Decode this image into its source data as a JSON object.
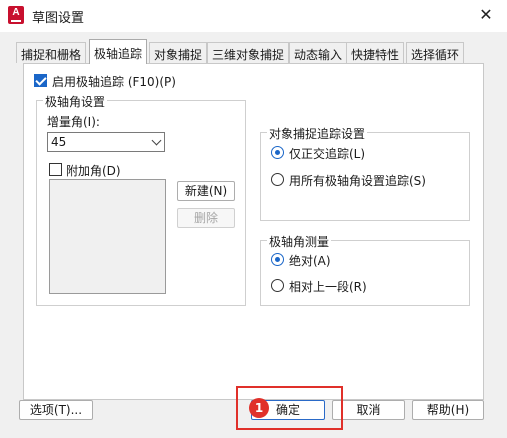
{
  "window": {
    "title": "草图设置",
    "close_glyph": "✕",
    "app_icon": "autocad-icon",
    "app_icon_letter": "A"
  },
  "tabs": [
    {
      "label": "捕捉和栅格",
      "active": false
    },
    {
      "label": "极轴追踪",
      "active": true
    },
    {
      "label": "对象捕捉",
      "active": false
    },
    {
      "label": "三维对象捕捉",
      "active": false
    },
    {
      "label": "动态输入",
      "active": false
    },
    {
      "label": "快捷特性",
      "active": false
    },
    {
      "label": "选择循环",
      "active": false
    }
  ],
  "polar": {
    "enable_label": "启用极轴追踪 (F10)(P)",
    "enabled": true,
    "angle_group": {
      "title": "极轴角设置",
      "increment_label": "增量角(I):",
      "increment_value": "45",
      "additional_label": "附加角(D)",
      "additional_checked": false,
      "new_button": "新建(N)",
      "delete_button": "删除"
    },
    "snap_tracking": {
      "title": "对象捕捉追踪设置",
      "option1": "仅正交追踪(L)",
      "option2": "用所有极轴角设置追踪(S)",
      "selected": 1
    },
    "measurement": {
      "title": "极轴角测量",
      "option1": "绝对(A)",
      "option2": "相对上一段(R)",
      "selected": 1
    }
  },
  "footer": {
    "options_button": "选项(T)...",
    "ok_button": "确定",
    "cancel_button": "取消",
    "help_button": "帮助(H)"
  },
  "annotation": {
    "step_number": "1",
    "color": "#e0302a"
  },
  "colors": {
    "accent": "#1a66c8",
    "panel_bg": "#f0f0f0"
  }
}
